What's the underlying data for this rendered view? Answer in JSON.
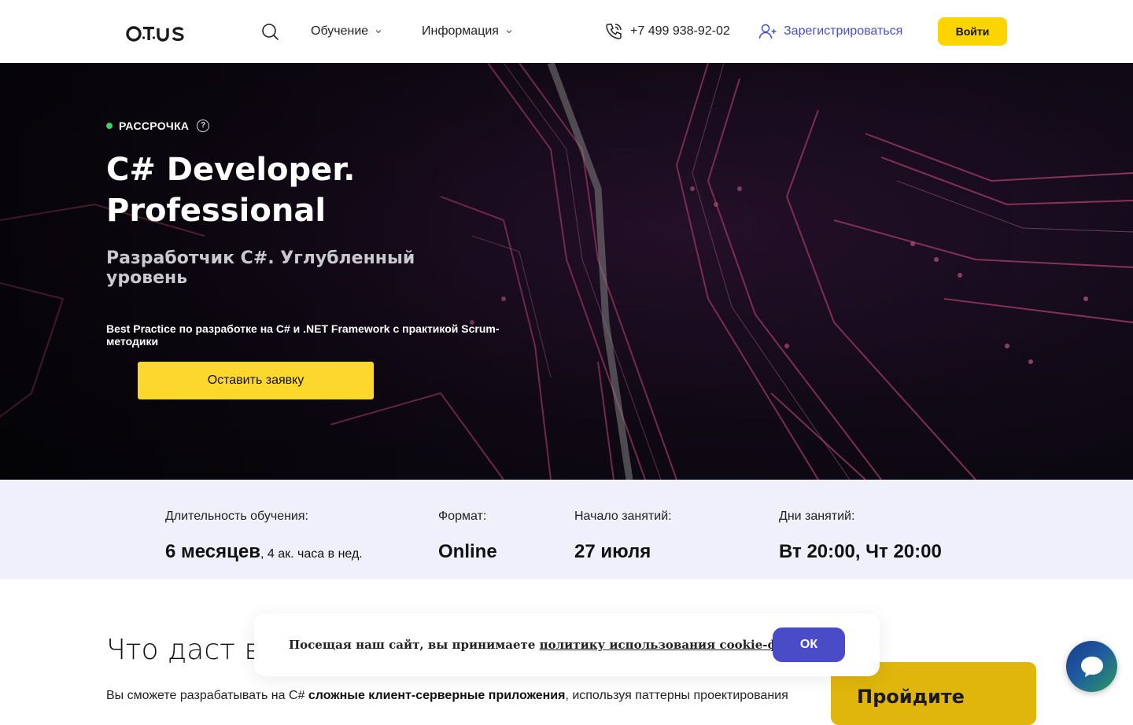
{
  "header": {
    "logo": "otus",
    "nav": [
      {
        "label": "Обучение"
      },
      {
        "label": "Информация"
      }
    ],
    "phone": "+7 499 938-92-02",
    "register": "Зарегистрироваться",
    "login": "Войти"
  },
  "hero": {
    "badge": "РАССРОЧКА",
    "help_glyph": "?",
    "title": "C# Developer. Professional",
    "subtitle": "Разработчик C#. Углубленный уровень",
    "description": "Best Practice по разработке на C# и .NET Framework с практикой Scrum-методики",
    "cta": "Оставить заявку"
  },
  "info": {
    "duration_label": "Длительность обучения:",
    "duration_value": "6 месяцев",
    "duration_extra": ", 4 ак. часа в нед.",
    "format_label": "Формат:",
    "format_value": "Online",
    "start_label": "Начало занятий:",
    "start_value": "27 июля",
    "days_label": "Дни занятий:",
    "days_value": "Вт 20:00, Чт 20:00"
  },
  "what": {
    "title": "Что даст вам",
    "text_start": "Вы сможете разрабатывать на C# ",
    "text_bold": "сложные клиент-серверные приложения",
    "text_end": ", используя паттерны проектирования"
  },
  "promo": {
    "title": "Пройдите"
  },
  "cookie": {
    "text": "Посещая наш сайт, вы принимаете ",
    "link": "политику использования cookie-файлов",
    "ok": "ОК"
  },
  "colors": {
    "accent_yellow": "#fcd500",
    "accent_blue": "#4a4bc6",
    "info_bg": "#eff0fb",
    "badge_dot": "#3ccf6a"
  },
  "icons": [
    "search-icon",
    "chevron-down-icon",
    "phone-icon",
    "add-user-icon",
    "question-icon",
    "chat-icon"
  ]
}
